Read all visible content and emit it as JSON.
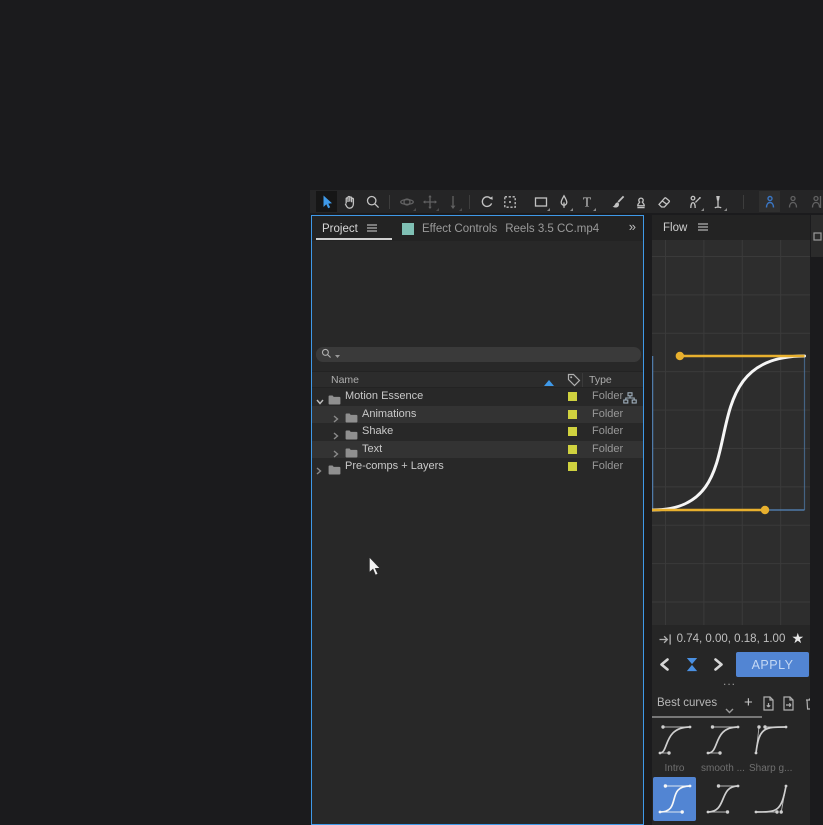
{
  "colors": {
    "accent_blue": "#3f99e8",
    "label_yellow": "#d0d23f",
    "handle_gold": "#e8b02e",
    "curve_white": "#f5f5f5",
    "box_blue": "#4f7aa8",
    "apply_blue": "#5285d3",
    "tab_doc_teal": "#7fc0b4",
    "flow_logo_blue": "#4a90e2"
  },
  "toolbar": {
    "tools": [
      {
        "icon": "selection",
        "active": true
      },
      {
        "icon": "hand"
      },
      {
        "icon": "zoom"
      },
      {
        "separator": true
      },
      {
        "icon": "orbit-camera",
        "disabled": true,
        "flyout": true
      },
      {
        "icon": "pan-camera",
        "disabled": true,
        "flyout": true
      },
      {
        "icon": "dolly-camera",
        "disabled": true,
        "flyout": true
      },
      {
        "separator": true
      },
      {
        "icon": "rotation"
      },
      {
        "icon": "camera-region"
      },
      {
        "gap": true
      },
      {
        "icon": "rectangle",
        "flyout": true
      },
      {
        "icon": "pen",
        "flyout": true
      },
      {
        "icon": "type",
        "flyout": true
      },
      {
        "gap": true
      },
      {
        "icon": "brush"
      },
      {
        "icon": "clone-stamp"
      },
      {
        "icon": "eraser"
      },
      {
        "gap": true
      },
      {
        "icon": "roto-brush",
        "flyout": true
      },
      {
        "icon": "puppet-pin",
        "flyout": true
      },
      {
        "separator": true,
        "wide": true
      },
      {
        "icon": "person-highlight",
        "boxed": true
      },
      {
        "icon": "person",
        "disabled": true
      },
      {
        "icon": "person-partial",
        "disabled": true
      }
    ]
  },
  "project_panel": {
    "tabs": [
      {
        "label": "Project",
        "active": true
      },
      {
        "label": "Effect Controls",
        "document": "Reels 3.5 CC.mp4",
        "active": false
      }
    ],
    "overflow_chevrons": "»",
    "search": {
      "placeholder": ""
    },
    "columns": {
      "name_label": "Name",
      "type_label": "Type",
      "sort": "ascending"
    },
    "rows": [
      {
        "name": "Motion Essence",
        "type": "Folder",
        "indent": 0,
        "state": "expanded",
        "label_color": "#d0d23f",
        "trailing_icon": "hierarchy-icon"
      },
      {
        "name": "Animations",
        "type": "Folder",
        "indent": 1,
        "state": "collapsed",
        "label_color": "#d0d23f"
      },
      {
        "name": "Shake",
        "type": "Folder",
        "indent": 1,
        "state": "collapsed",
        "label_color": "#d0d23f"
      },
      {
        "name": "Text",
        "type": "Folder",
        "indent": 1,
        "state": "collapsed",
        "label_color": "#d0d23f"
      },
      {
        "name": "Pre-comps + Layers",
        "type": "Folder",
        "indent": 0,
        "state": "collapsed",
        "label_color": "#d0d23f"
      }
    ]
  },
  "flow_panel": {
    "title": "Flow",
    "curve": {
      "bezier": [
        0.74,
        0.0,
        0.18,
        1.0
      ]
    },
    "values_text": "0.74, 0.00, 0.18, 1.00",
    "star_icon": "★",
    "apply_label": "APPLY",
    "more_dots": "...",
    "library": {
      "selected": "Best curves"
    },
    "presets": [
      {
        "label": "Intro",
        "bezier": [
          0.3,
          0,
          0.1,
          1
        ]
      },
      {
        "label": "smooth ...",
        "bezier": [
          0.4,
          0,
          0.15,
          1
        ]
      },
      {
        "label": "Sharp g...",
        "bezier": [
          0.1,
          1,
          0.3,
          1
        ]
      },
      {
        "bezier": [
          0.74,
          0,
          0.18,
          1
        ],
        "selected": true
      },
      {
        "bezier": [
          0.65,
          0,
          0.35,
          1
        ]
      },
      {
        "bezier": [
          0.7,
          0,
          0.84,
          0
        ]
      }
    ]
  }
}
